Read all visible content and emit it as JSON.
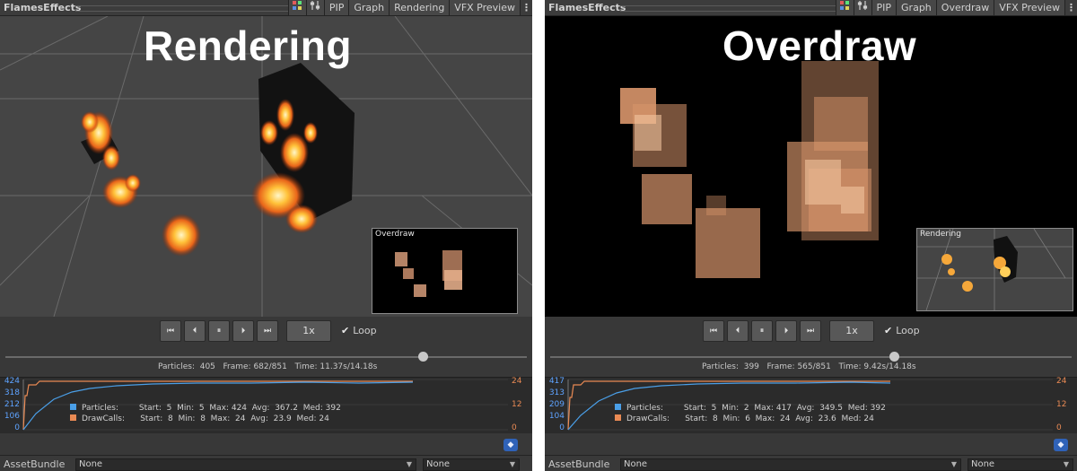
{
  "panels": [
    {
      "window_title": "FlamesEffects",
      "tabs": [
        "PIP",
        "Graph",
        "Rendering",
        "VFX Preview"
      ],
      "overlay_label": "Rendering",
      "pip_label": "Overdraw",
      "playback": {
        "speed": "1x",
        "loop_label": "Loop",
        "loop_checked": true,
        "progress": 0.8
      },
      "stats": {
        "particles_label": "Particles:",
        "particles": "405",
        "frame_label": "Frame:",
        "frame": "682/851",
        "time_label": "Time:",
        "time": "11.37s/14.18s"
      },
      "graph": {
        "left_axis": [
          "424",
          "318",
          "212",
          "106",
          "0"
        ],
        "right_axis": [
          "24",
          "12",
          "0"
        ],
        "particles_row": {
          "name": "Particles:",
          "start_label": "Start:",
          "start": "5",
          "min_label": "Min:",
          "min": "5",
          "max_label": "Max:",
          "max": "424",
          "avg_label": "Avg:",
          "avg": "367.2",
          "med_label": "Med:",
          "med": "392"
        },
        "drawcalls_row": {
          "name": "DrawCalls:",
          "start_label": "Start:",
          "start": "8",
          "min_label": "Min:",
          "min": "8",
          "max_label": "Max:",
          "max": "24",
          "avg_label": "Avg:",
          "avg": "23.9",
          "med_label": "Med:",
          "med": "24"
        }
      },
      "asset_bundle": {
        "label": "AssetBundle",
        "value1": "None",
        "value2": "None"
      }
    },
    {
      "window_title": "FlamesEffects",
      "tabs": [
        "PIP",
        "Graph",
        "Overdraw",
        "VFX Preview"
      ],
      "overlay_label": "Overdraw",
      "pip_label": "Rendering",
      "playback": {
        "speed": "1x",
        "loop_label": "Loop",
        "loop_checked": true,
        "progress": 0.66
      },
      "stats": {
        "particles_label": "Particles:",
        "particles": "399",
        "frame_label": "Frame:",
        "frame": "565/851",
        "time_label": "Time:",
        "time": "9.42s/14.18s"
      },
      "graph": {
        "left_axis": [
          "417",
          "313",
          "209",
          "104",
          "0"
        ],
        "right_axis": [
          "24",
          "12",
          "0"
        ],
        "particles_row": {
          "name": "Particles:",
          "start_label": "Start:",
          "start": "5",
          "min_label": "Min:",
          "min": "2",
          "max_label": "Max:",
          "max": "417",
          "avg_label": "Avg:",
          "avg": "349.5",
          "med_label": "Med:",
          "med": "392"
        },
        "drawcalls_row": {
          "name": "DrawCalls:",
          "start_label": "Start:",
          "start": "8",
          "min_label": "Min:",
          "min": "6",
          "max_label": "Max:",
          "max": "24",
          "avg_label": "Avg:",
          "avg": "23.6",
          "med_label": "Med:",
          "med": "24"
        }
      },
      "asset_bundle": {
        "label": "AssetBundle",
        "value1": "None",
        "value2": "None"
      }
    }
  ],
  "colors": {
    "particles_series": "#4a9fe8",
    "drawcalls_series": "#e98a54",
    "asset_bundle_icon": "#2f62b8"
  },
  "icons": {
    "toolbar": [
      "color-swatch-icon",
      "settings-sliders-icon"
    ],
    "playback": [
      "skip-to-start-icon",
      "step-back-icon",
      "pause-icon",
      "step-forward-icon",
      "skip-to-end-icon"
    ],
    "checkbox": "checkmark-icon",
    "bundle": "tag-icon"
  }
}
